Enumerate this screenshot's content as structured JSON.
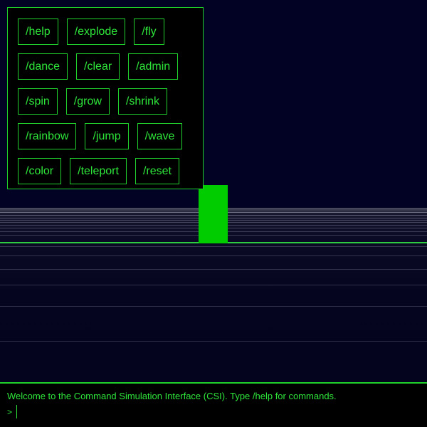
{
  "commands": {
    "rows": [
      [
        "/help",
        "/explode",
        "/fly"
      ],
      [
        "/dance",
        "/clear",
        "/admin"
      ],
      [
        "/spin",
        "/grow",
        "/shrink"
      ],
      [
        "/rainbow",
        "/jump",
        "/wave"
      ],
      [
        "/color",
        "/teleport",
        "/reset"
      ]
    ]
  },
  "console": {
    "message": "Welcome to the Command Simulation Interface (CSI). Type /help for commands.",
    "prompt": ">",
    "input_value": ""
  },
  "colors": {
    "accent": "#1fd12a",
    "text": "#2ee63a",
    "player": "#00cc00",
    "background": "#020224"
  }
}
